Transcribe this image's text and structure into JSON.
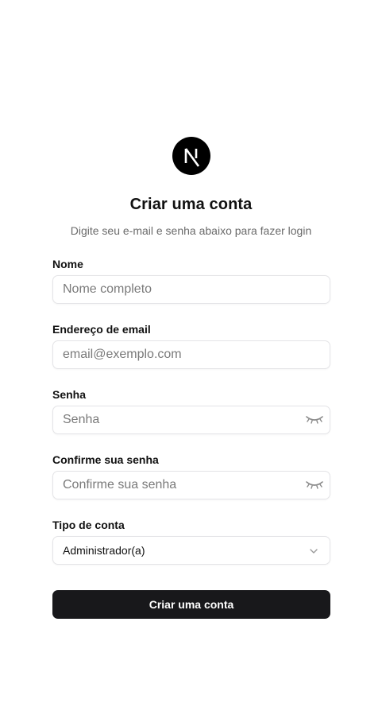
{
  "brand": {
    "logo_icon": "nextjs-logo-icon",
    "logo_letter": "N"
  },
  "header": {
    "title": "Criar uma conta",
    "subtitle": "Digite seu e-mail e senha abaixo para fazer login"
  },
  "form": {
    "name": {
      "label": "Nome",
      "placeholder": "Nome completo",
      "value": ""
    },
    "email": {
      "label": "Endereço de email",
      "placeholder": "email@exemplo.com",
      "value": ""
    },
    "password": {
      "label": "Senha",
      "placeholder": "Senha",
      "value": "",
      "toggle_icon": "eye-closed-icon"
    },
    "confirm_password": {
      "label": "Confirme sua senha",
      "placeholder": "Confirme sua senha",
      "value": "",
      "toggle_icon": "eye-closed-icon"
    },
    "account_type": {
      "label": "Tipo de conta",
      "selected": "Administrador(a)",
      "icon": "chevron-down-icon"
    },
    "submit_label": "Criar uma conta"
  },
  "colors": {
    "primary_button": "#18181b",
    "border": "#e4e4e7",
    "muted_text": "#6b6b6b"
  }
}
